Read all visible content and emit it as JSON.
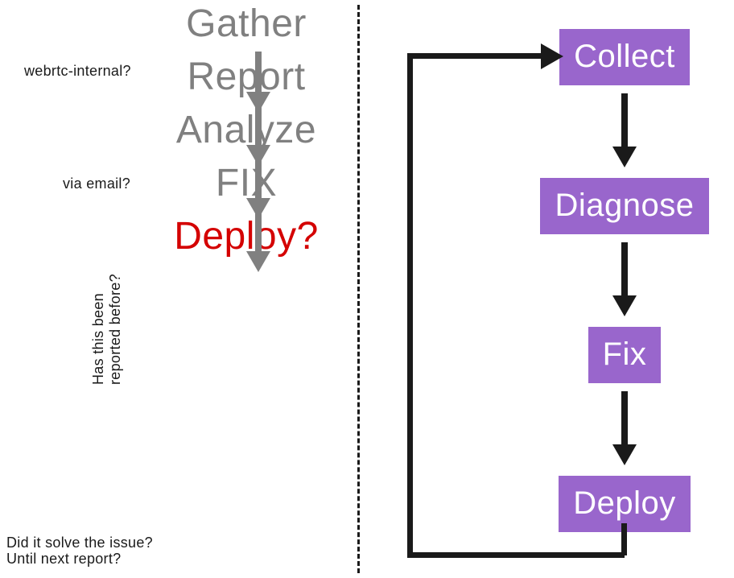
{
  "left": {
    "steps": [
      "Gather",
      "Report",
      "Analyze",
      "FIX",
      "Deploy?"
    ],
    "highlight_index": 4,
    "annotations": {
      "gather": "webrtc-internal?",
      "report": "via email?",
      "analyze": "Has this been\nreported before?",
      "deploy_a": "Did it solve the issue?",
      "deploy_b": "Until next report?"
    }
  },
  "right": {
    "boxes": [
      "Collect",
      "Diagnose",
      "Fix",
      "Deploy"
    ]
  },
  "colors": {
    "grey": "#808080",
    "red": "#d40000",
    "purple": "#9966cc",
    "ink": "#1a1a1a"
  }
}
